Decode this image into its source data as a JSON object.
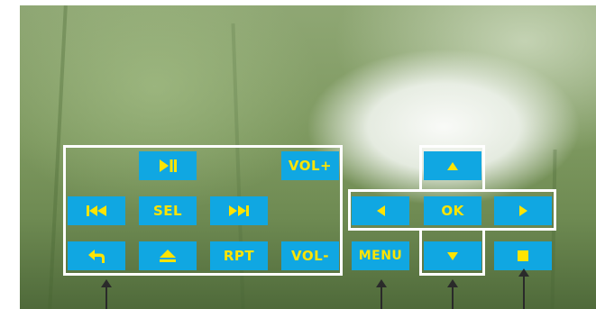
{
  "buttons": {
    "play_pause": "play-pause-icon",
    "vol_up": "VOL+",
    "previous": "previous-icon",
    "sel": "SEL",
    "next": "next-icon",
    "back": "back-icon",
    "eject": "eject-icon",
    "rpt": "RPT",
    "vol_down": "VOL-",
    "menu": "MENU",
    "up": "up-icon",
    "left": "left-icon",
    "ok": "OK",
    "right": "right-icon",
    "down": "down-icon",
    "stop": "stop-icon"
  },
  "colors": {
    "button_bg": "#10a7e2",
    "button_fg": "#ffe400",
    "outline": "#ffffff",
    "pointer": "#2a2a2a"
  }
}
